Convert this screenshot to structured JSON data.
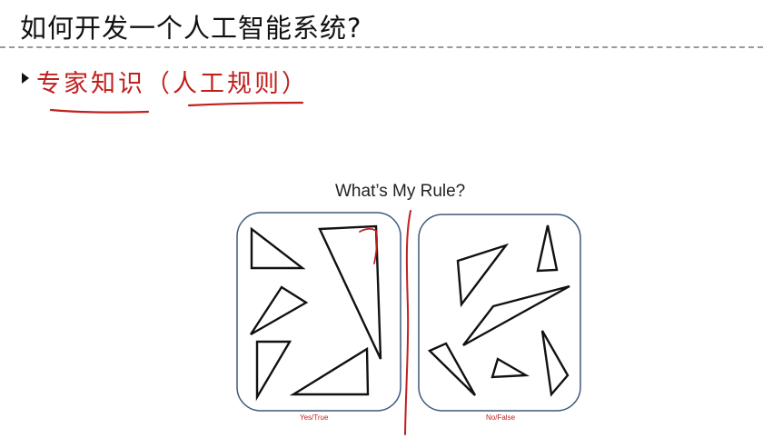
{
  "slide": {
    "title": "如何开发一个人工智能系统?",
    "bullet": "专家知识（人工规则）"
  },
  "figure": {
    "title": "What’s My Rule?",
    "left_box_caption": "Yes/True",
    "right_box_caption": "No/False",
    "left_box_shape": "right-triangle",
    "right_box_shape": "non-right-triangle"
  },
  "colors": {
    "annotation_red": "#c0201e",
    "box_border": "#3d5a7a",
    "title_text": "#111111"
  },
  "icons": {
    "bullet": "triangle-bullet-icon"
  }
}
